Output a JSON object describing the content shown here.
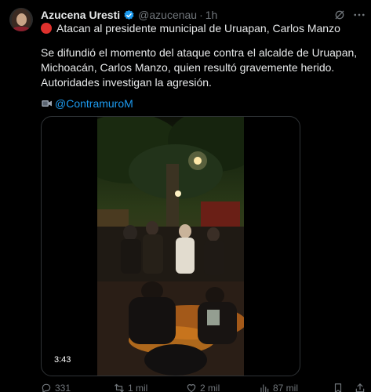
{
  "tweet": {
    "author_name": "Azucena Uresti",
    "handle": "@azucenau",
    "separator": "·",
    "time": "1h",
    "headline": "Atacan al presidente municipal de Uruapan, Carlos Manzo",
    "body": "Se difundió el momento del ataque contra el alcalde de Uruapan, Michoacán, Carlos Manzo, quien resultó gravemente herido. Autoridades investigan la agresión.",
    "mention": "@ContramuroM"
  },
  "video": {
    "duration": "3:43"
  },
  "actions": {
    "replies": "331",
    "retweets": "1 mil",
    "likes": "2 mil",
    "views": "87 mil"
  },
  "icons": {
    "verified": "verified-badge-icon",
    "grok": "grok-icon",
    "more": "more-icon",
    "headline_marker": "red-circle-icon",
    "mention_marker": "video-camera-icon",
    "reply": "reply-icon",
    "retweet": "retweet-icon",
    "like": "heart-icon",
    "views": "views-icon",
    "bookmark": "bookmark-icon",
    "share": "share-icon"
  },
  "colors": {
    "background": "#000000",
    "text": "#e7e9ea",
    "muted": "#71767b",
    "link": "#1d9bf0",
    "verified": "#1d9bf0",
    "red_marker": "#e0312d"
  }
}
